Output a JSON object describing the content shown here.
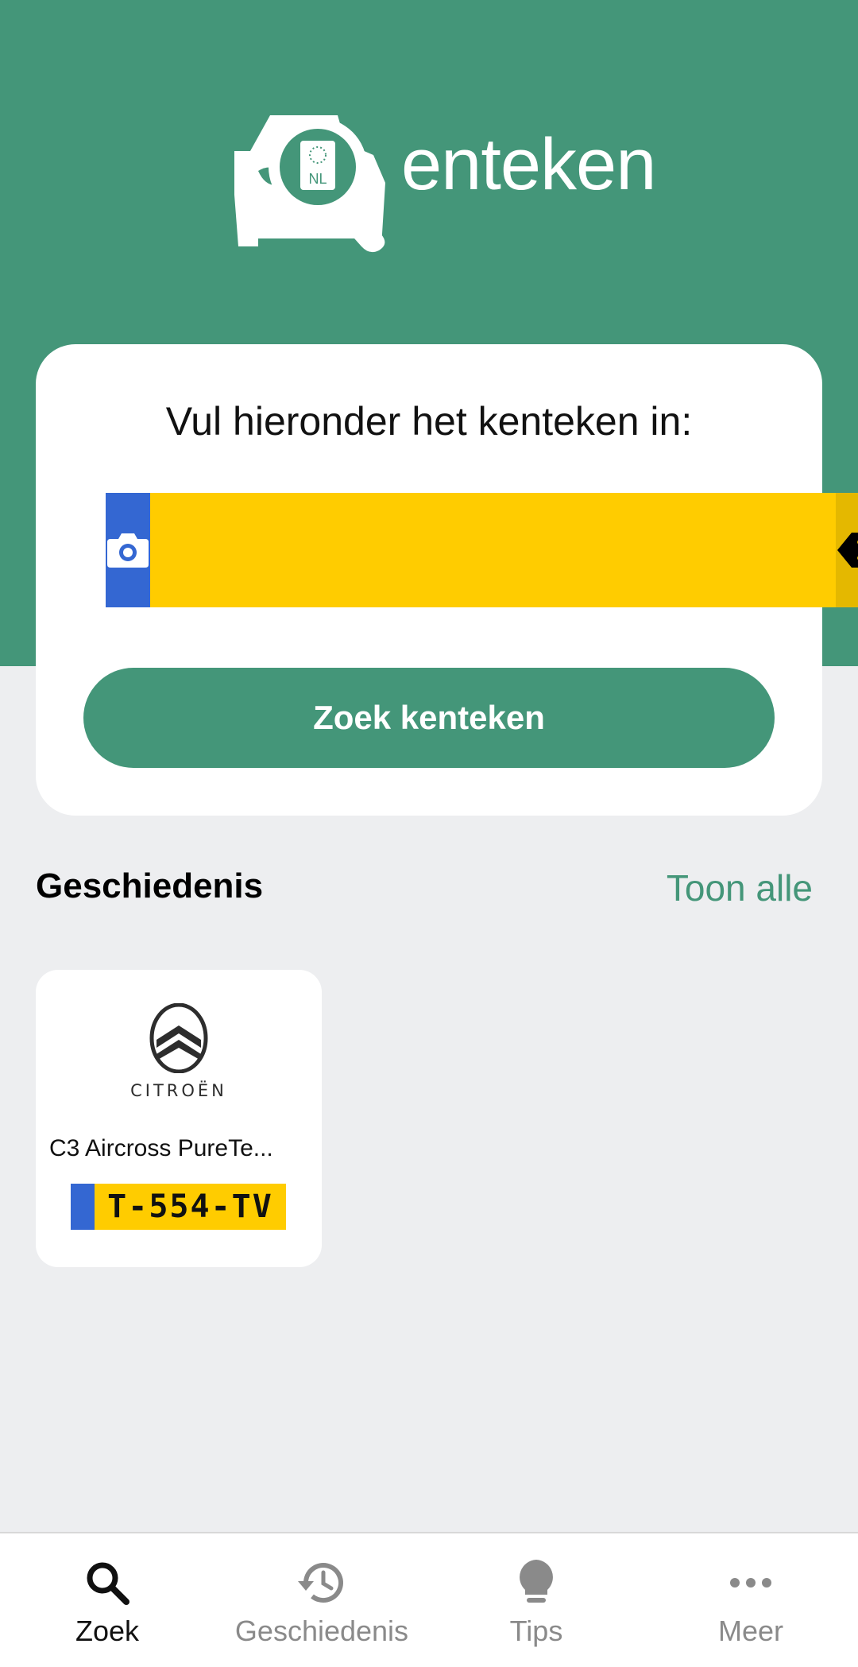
{
  "app": {
    "logo_text": "enteken",
    "plate_country": "NL"
  },
  "search_card": {
    "title": "Vul hieronder het kenteken in:",
    "input_value": "",
    "search_button_label": "Zoek kenteken"
  },
  "history": {
    "title": "Geschiedenis",
    "show_all_label": "Toon alle",
    "items": [
      {
        "brand": "CITROËN",
        "model": "C3 Aircross PureTe...",
        "plate": "T-554-TV"
      }
    ]
  },
  "bottom_nav": {
    "items": [
      {
        "label": "Zoek",
        "icon": "search-icon",
        "active": true
      },
      {
        "label": "Geschiedenis",
        "icon": "history-icon",
        "active": false
      },
      {
        "label": "Tips",
        "icon": "lightbulb-icon",
        "active": false
      },
      {
        "label": "Meer",
        "icon": "more-icon",
        "active": false
      }
    ]
  },
  "colors": {
    "brand_green": "#449679",
    "plate_yellow": "#ffcc00",
    "plate_blue": "#3467d2",
    "background": "#edeef0"
  }
}
